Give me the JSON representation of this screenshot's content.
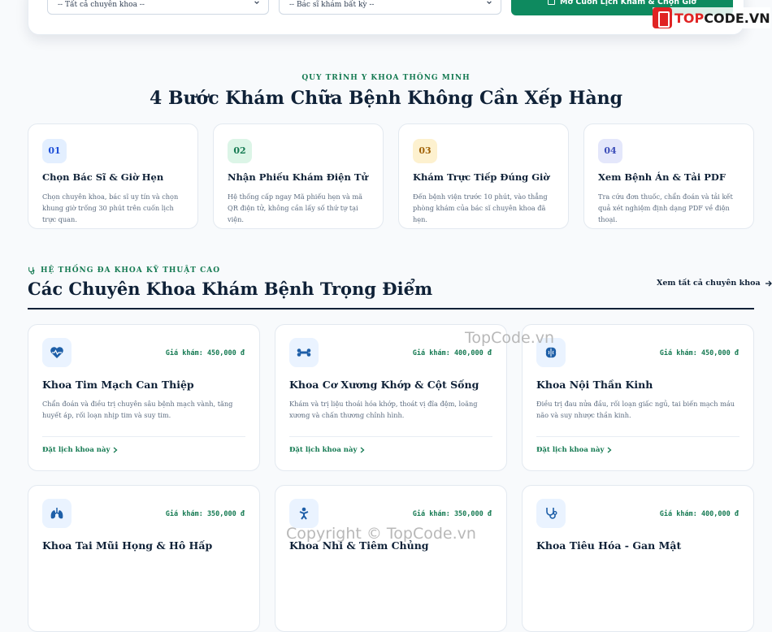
{
  "booking": {
    "specialty_select": "-- Tất cả chuyên khoa --",
    "doctor_select": "-- Bác sĩ khám bất kỳ --",
    "submit_label": "Mở Cuốn Lịch Khám & Chọn Giờ"
  },
  "watermark": {
    "brand_prefix": "TOP",
    "brand_suffix": "CODE.VN",
    "text1": "TopCode.vn",
    "text2": "Copyright © TopCode.vn"
  },
  "process": {
    "eyebrow": "QUY TRÌNH Y KHOA THÔNG MINH",
    "title": "4 Bước Khám Chữa Bệnh Không Cần Xếp Hàng",
    "steps": [
      {
        "num": "01",
        "title": "Chọn Bác Sĩ & Giờ Hẹn",
        "desc": "Chọn chuyên khoa, bác sĩ uy tín và chọn khung giờ trống 30 phút trên cuốn lịch trực quan.",
        "bg": "#e3efff",
        "color": "#1d4ed8"
      },
      {
        "num": "02",
        "title": "Nhận Phiếu Khám Điện Tử",
        "desc": "Hệ thống cấp ngay Mã phiếu hẹn và mã QR điện tử, không cần lấy số thứ tự tại viện.",
        "bg": "#dcf5e7",
        "color": "#157a52"
      },
      {
        "num": "03",
        "title": "Khám Trực Tiếp Đúng Giờ",
        "desc": "Đến bệnh viện trước 10 phút, vào thẳng phòng khám của bác sĩ chuyên khoa đã hẹn.",
        "bg": "#fdf1cf",
        "color": "#a16207"
      },
      {
        "num": "04",
        "title": "Xem Bệnh Án & Tải PDF",
        "desc": "Tra cứu đơn thuốc, chẩn đoán và tải kết quả xét nghiệm định dạng PDF về điện thoại.",
        "bg": "#e4e7fb",
        "color": "#3b4cb8"
      }
    ]
  },
  "specialties": {
    "eyebrow": "HỆ THỐNG ĐA KHOA KỸ THUẬT CAO",
    "title": "Các Chuyên Khoa Khám Bệnh Trọng Điểm",
    "see_all": "Xem tất cả chuyên khoa",
    "cards": [
      {
        "icon": "heart-pulse-icon",
        "price": "Giá khám: 450,000 đ",
        "title": "Khoa Tim Mạch Can Thiệp",
        "desc": "Chẩn đoán và điều trị chuyên sâu bệnh mạch vành, tăng huyết áp, rối loạn nhịp tim và suy tim.",
        "link": "Đặt lịch khoa này"
      },
      {
        "icon": "bone-icon",
        "price": "Giá khám: 400,000 đ",
        "title": "Khoa Cơ Xương Khớp & Cột Sống",
        "desc": "Khám và trị liệu thoái hóa khớp, thoát vị đĩa đệm, loãng xương và chấn thương chỉnh hình.",
        "link": "Đặt lịch khoa này"
      },
      {
        "icon": "brain-icon",
        "price": "Giá khám: 450,000 đ",
        "title": "Khoa Nội Thần Kinh",
        "desc": "Điều trị đau nửa đầu, rối loạn giấc ngủ, tai biến mạch máu não và suy nhược thần kinh.",
        "link": "Đặt lịch khoa này"
      },
      {
        "icon": "lungs-icon",
        "price": "Giá khám: 350,000 đ",
        "title": "Khoa Tai Mũi Họng & Hô Hấp",
        "desc": "",
        "link": ""
      },
      {
        "icon": "child-icon",
        "price": "Giá khám: 350,000 đ",
        "title": "Khoa Nhi & Tiêm Chủng",
        "desc": "",
        "link": ""
      },
      {
        "icon": "stethoscope-icon",
        "price": "Giá khám: 400,000 đ",
        "title": "Khoa Tiêu Hóa - Gan Mật",
        "desc": "",
        "link": ""
      }
    ]
  }
}
